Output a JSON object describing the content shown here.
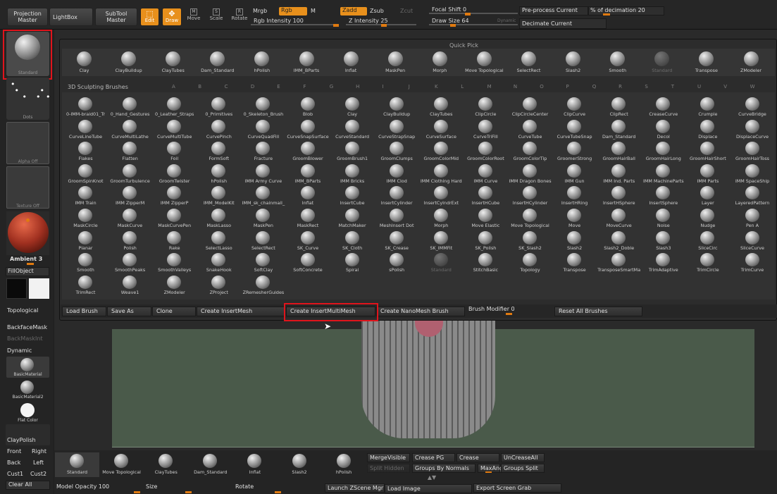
{
  "top": {
    "projection_master": "Projection Master",
    "lightbox": "LightBox",
    "subtool_master": "SubTool Master",
    "edit": "Edit",
    "draw": "Draw",
    "move": "Move",
    "scale": "Scale",
    "rotate": "Rotate",
    "mrgb": "Mrgb",
    "rgb": "Rgb",
    "m": "M",
    "zadd": "Zadd",
    "zsub": "Zsub",
    "zcut": "Zcut",
    "rgb_intensity": "Rgb Intensity 100",
    "z_intensity": "Z Intensity 25",
    "focal_shift": "Focal Shift 0",
    "draw_size": "Draw Size 64",
    "dynamic": "Dynamic",
    "preprocess": "Pre-process Current",
    "decimation": "% of decimation 20",
    "decimate_current": "Decimate Current"
  },
  "left": {
    "standard": "Standard",
    "dots": "Dots",
    "alpha_off": "Alpha Off",
    "texture_off": "Texture Off",
    "ambient": "Ambient 3",
    "fillobject": "FillObject",
    "topological": "Topological",
    "backfacemask": "BackfaceMask",
    "backmaskint": "BackMaskInt",
    "dynamic": "Dynamic",
    "basicmaterial": "BasicMaterial",
    "basicmaterial2": "BasicMaterial2",
    "flat_color": "Flat Color",
    "claypolish": "ClayPolish",
    "front": "Front",
    "right": "Right",
    "back": "Back",
    "left": "Left",
    "cust1": "Cust1",
    "cust2": "Cust2",
    "clear_all": "Clear All"
  },
  "quick_pick": {
    "title": "Quick Pick",
    "items": [
      "Clay",
      "ClayBuildup",
      "ClayTubes",
      "Dam_Standard",
      "hPolish",
      "IMM_BParts",
      "Inflat",
      "MaskPen",
      "Morph",
      "Move Topological",
      "SelectRect",
      "Slash2",
      "Smooth",
      "Standard",
      "Transpose",
      "ZModeler"
    ]
  },
  "brushes": {
    "title": "3D Sculpting Brushes",
    "letters": [
      "A",
      "B",
      "C",
      "D",
      "E",
      "F",
      "G",
      "H",
      "I",
      "J",
      "K",
      "L",
      "M",
      "N",
      "O",
      "P",
      "Q",
      "R",
      "S",
      "T",
      "U",
      "V",
      "W"
    ],
    "rows": [
      [
        "0-IMM-braid01_Tr",
        "0_Hand_Gestures",
        "0_Leather_Straps",
        "0_Primitives",
        "0_Skeleton_Brush",
        "Blob",
        "Clay",
        "ClayBuildup",
        "ClayTubes",
        "ClipCircle",
        "ClipCircleCenter",
        "ClipCurve",
        "ClipRect",
        "CreaseCurve",
        "Crumple",
        "CurveBridge"
      ],
      [
        "CurveLineTube",
        "CurveMultiLathe",
        "CurveMultiTube",
        "CurvePinch",
        "CurveQuadFill",
        "CurveSnapSurface",
        "CurveStandard",
        "CurveStrapSnap",
        "CurveSurface",
        "CurveTriFill",
        "CurveTube",
        "CurveTubeSnap",
        "Dam_Standard",
        "Decol",
        "Displace",
        "DisplaceCurve"
      ],
      [
        "Flakes",
        "Flatten",
        "Foil",
        "FormSoft",
        "Fracture",
        "GroomBlower",
        "GroomBrush1",
        "GroomClumps",
        "GroomColorMid",
        "GroomColorRoot",
        "GroomColorTip",
        "GroomerStrong",
        "GroomHairBall",
        "GroomHairLong",
        "GroomHairShort",
        "GroomHairToss"
      ],
      [
        "GroomSpinKnot",
        "GroomTurbulence",
        "GroomTwister",
        "hPolish",
        "IMM Army Curve",
        "IMM_BParts",
        "IMM Bricks",
        "IMM Clod",
        "IMM Clothing Hard",
        "IMM Curve",
        "IMM Dragon Bones",
        "IMM Gun",
        "IMM Ind. Parts",
        "IMM MachineParts",
        "IMM Parts",
        "IMM SpaceShip"
      ],
      [
        "IMM Train",
        "IMM ZipperM",
        "IMM ZipperP",
        "IMM_ModelKit",
        "IMM_sk_chainmail_",
        "Inflat",
        "InsertCube",
        "InsertCylinder",
        "InsertCylndrExt",
        "InsertHCube",
        "InsertHCylinder",
        "InsertHRing",
        "InsertHSphere",
        "InsertSphere",
        "Layer",
        "LayeredPattern"
      ],
      [
        "MaskCircle",
        "MaskCurve",
        "MaskCurvePen",
        "MaskLasso",
        "MaskPen",
        "MaskRect",
        "MatchMaker",
        "MeshInsert Dot",
        "Morph",
        "Move Elastic",
        "Move Topological",
        "Move",
        "MoveCurve",
        "Noise",
        "Nudge",
        "Pen A"
      ],
      [
        "Planar",
        "Polish",
        "Rake",
        "SelectLasso",
        "SelectRect",
        "SK_Curve",
        "SK_Cloth",
        "SK_Crease",
        "SK_IMMFit",
        "SK_Polish",
        "SK_Slash2",
        "Slash2",
        "Slash2_Doble",
        "Slash3",
        "SliceCirc",
        "SliceCurve"
      ],
      [
        "Smooth",
        "SmoothPeaks",
        "SmoothValleys",
        "SnakeHook",
        "SoftClay",
        "SoftConcrete",
        "Spiral",
        "sPolish",
        "Standard",
        "StitchBasic",
        "Topology",
        "Transpose",
        "TransposeSmartMa",
        "TrimAdaptive",
        "TrimCircle",
        "TrimCurve"
      ],
      [
        "TrimRect",
        "Weave1",
        "ZModeler",
        "ZProject",
        "ZRemesherGuides"
      ]
    ]
  },
  "brush_bar": {
    "load": "Load Brush",
    "save": "Save As",
    "clone": "Clone",
    "insertmesh": "Create InsertMesh",
    "insertmultimesh": "Create InsertMultiMesh",
    "nanomesh": "Create NanoMesh Brush",
    "modifier": "Brush Modifier 0",
    "reset": "Reset All Brushes"
  },
  "bottom": {
    "tray": [
      "Standard",
      "Move Topological",
      "ClayTubes",
      "Dam_Standard",
      "Inflat",
      "Slash2",
      "hPolish"
    ],
    "mergevisible": "MergeVisible",
    "crease_pg": "Crease PG",
    "crease": "Crease",
    "uncrease_all": "UnCreaseAll",
    "split_hidden": "Split Hidden",
    "groups_by_normals": "Groups By Normals",
    "maxangle": "MaxAng",
    "groups_split": "Groups Split",
    "model_opacity": "Model Opacity 100",
    "size": "Size",
    "rotate": "Rotate",
    "launch": "Launch ZScene Mgr",
    "load_image": "Load Image",
    "export": "Export Screen Grab"
  }
}
